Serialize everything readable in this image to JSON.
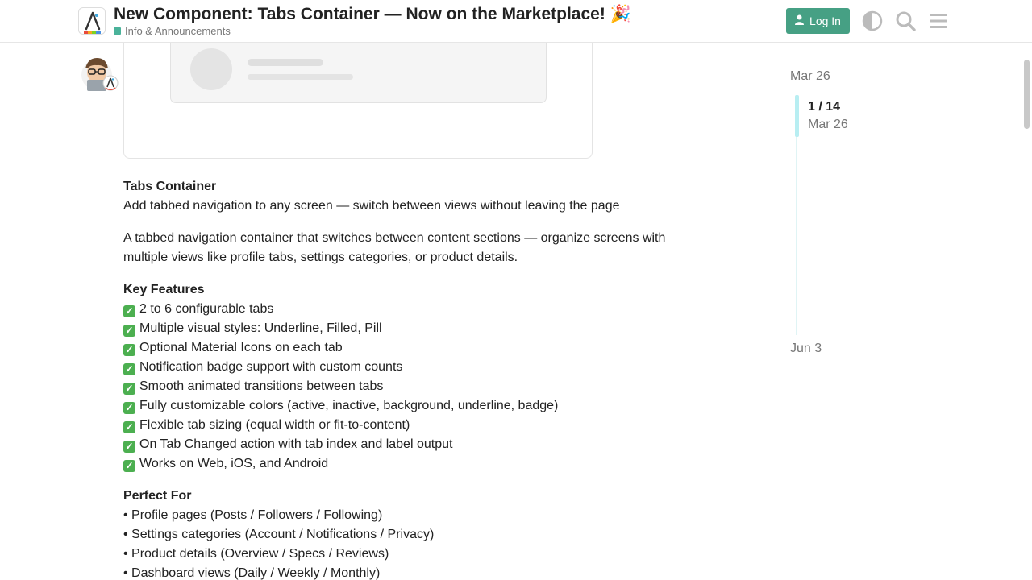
{
  "header": {
    "title": "New Component: Tabs Container — Now on the Marketplace! 🎉",
    "category": "Info & Announcements",
    "login_label": "Log In",
    "icons": [
      "theme-toggle-icon",
      "search-icon",
      "hamburger-menu-icon"
    ],
    "accent_color": "#46a084",
    "category_color": "#4ab29a"
  },
  "post": {
    "heading": "Tabs Container",
    "tagline": "Add tabbed navigation to any screen — switch between views without leaving the page",
    "description": "A tabbed navigation container that switches between content sections — organize screens with multiple views like profile tabs, settings categories, or product details.",
    "features_heading": "Key Features",
    "features": [
      "2 to 6 configurable tabs",
      "Multiple visual styles: Underline, Filled, Pill",
      "Optional Material Icons on each tab",
      "Notification badge support with custom counts",
      "Smooth animated transitions between tabs",
      "Fully customizable colors (active, inactive, background, underline, badge)",
      "Flexible tab sizing (equal width or fit-to-content)",
      "On Tab Changed action with tab index and label output",
      "Works on Web, iOS, and Android"
    ],
    "perfect_heading": "Perfect For",
    "perfect_for": [
      "• Profile pages (Posts / Followers / Following)",
      "• Settings categories (Account / Notifications / Privacy)",
      "• Product details (Overview / Specs / Reviews)",
      "• Dashboard views (Daily / Weekly / Monthly)"
    ]
  },
  "timeline": {
    "start_date": "Mar 26",
    "position": "1 / 14",
    "current_date": "Mar 26",
    "end_date": "Jun 3"
  }
}
